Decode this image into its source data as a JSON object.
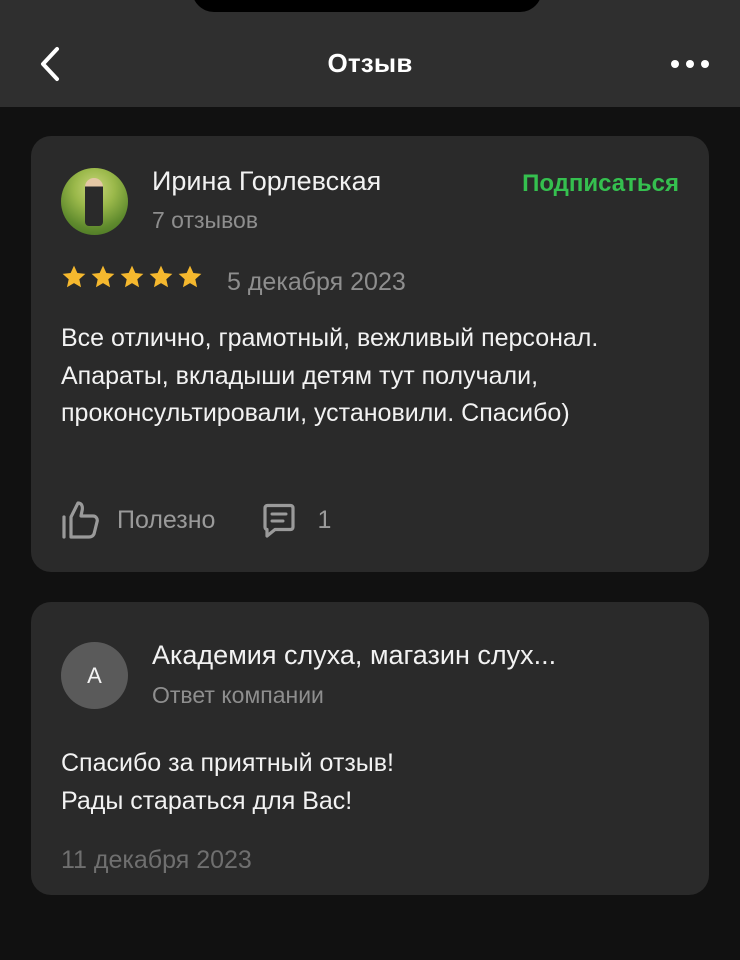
{
  "header": {
    "title": "Отзыв",
    "back_icon": "chevron-left-icon",
    "more_icon": "more-horizontal-icon"
  },
  "review": {
    "author_name": "Ирина Горлевская",
    "author_reviews": "7 отзывов",
    "subscribe_label": "Подписаться",
    "rating": 5,
    "rating_max": 5,
    "date": "5 декабря 2023",
    "text": "Все отлично, грамотный, вежливый персонал. Апараты, вкладыши детям тут получали, проконсультировали, установили. Спасибо)",
    "helpful_label": "Полезно",
    "comments_count": "1"
  },
  "reply": {
    "avatar_letter": "А",
    "company_name": "Академия слуха, магазин слух...",
    "role": "Ответ компании",
    "lines": [
      "Спасибо за приятный отзыв!",
      "Рады стараться для Вас!"
    ],
    "date": "11 декабря 2023"
  },
  "colors": {
    "accent_green": "#35c04f",
    "star_gold": "#f5b82e",
    "card_bg": "#2a2a2a",
    "page_bg": "#111111"
  }
}
